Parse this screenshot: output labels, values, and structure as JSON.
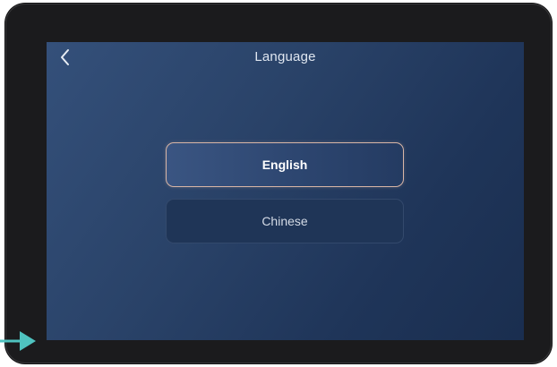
{
  "header": {
    "back_icon": "chevron-left-icon",
    "title": "Language"
  },
  "languages": [
    {
      "label": "English",
      "selected": true
    },
    {
      "label": "Chinese",
      "selected": false
    }
  ],
  "colors": {
    "bezel": "#1b1b1d",
    "screen_gradient_start": "#34507a",
    "screen_gradient_end": "#1a2e4f",
    "selected_border": "#d9b6a6",
    "pointer_arrow": "#4fc3c0"
  },
  "annotation": {
    "icon": "arrow-right-icon"
  }
}
